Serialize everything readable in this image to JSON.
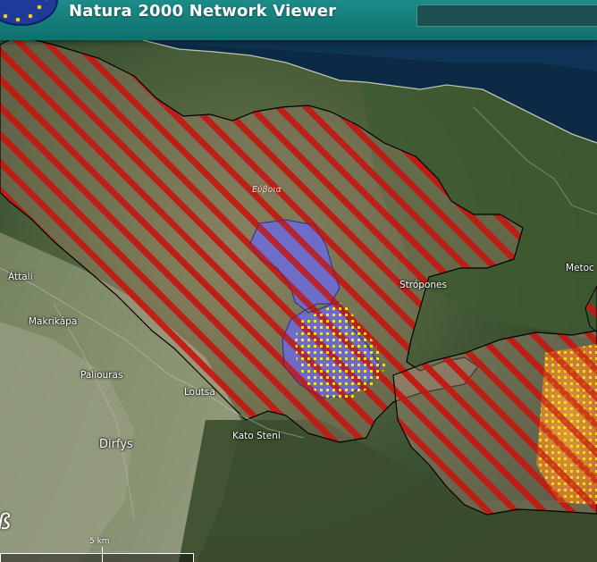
{
  "header": {
    "title": "Natura 2000 Network Viewer",
    "search_placeholder": ""
  },
  "map": {
    "basemap": "satellite imagery",
    "colors": {
      "sea": "#0c2a45",
      "sci_hatch": "#c41a12",
      "spa_fill": "#6a6ae0",
      "overlap_dots": "#ffe21a",
      "outline": "#000000"
    },
    "place_labels": {
      "attali": "Áttali",
      "makrikapa": "Makrikápa",
      "paliouras": "Paliouras",
      "loutsa": "Loutsa",
      "dirfys": "Dirfys",
      "kato_steni": "Kato Steni",
      "stropones": "Strópones",
      "metochi": "Metoc",
      "evvoia": "Εύβοια"
    },
    "edge_glyph": "ß"
  },
  "scalebar": {
    "label": "5 km"
  }
}
